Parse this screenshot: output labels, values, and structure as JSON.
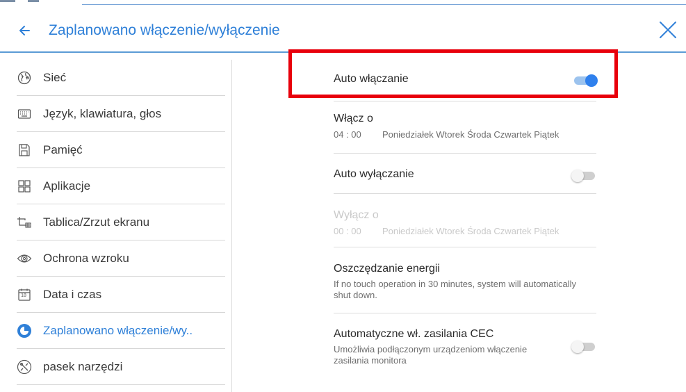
{
  "header": {
    "title": "Zaplanowano włączenie/wyłączenie",
    "back_icon": "arrow-left-icon",
    "close_icon": "close-icon"
  },
  "colors": {
    "accent": "#2f80d8",
    "divider": "#dcdcdc",
    "highlight": "#e8000b",
    "toggle_on": "#2f80ed"
  },
  "sidebar": {
    "items": [
      {
        "label": "Sieć",
        "icon": "globe-icon",
        "active": false
      },
      {
        "label": "Język, klawiatura, głos",
        "icon": "keyboard-icon",
        "active": false
      },
      {
        "label": "Pamięć",
        "icon": "storage-icon",
        "active": false
      },
      {
        "label": "Aplikacje",
        "icon": "apps-grid-icon",
        "active": false
      },
      {
        "label": "Tablica/Zrzut ekranu",
        "icon": "screenshot-icon",
        "active": false
      },
      {
        "label": "Ochrona wzroku",
        "icon": "eye-icon",
        "active": false
      },
      {
        "label": "Data i czas",
        "icon": "calendar-icon",
        "calendar_day": "18",
        "active": false
      },
      {
        "label": "Zaplanowano włączenie/wy..",
        "icon": "clock-icon",
        "active": true
      },
      {
        "label": "pasek narzędzi",
        "icon": "tools-icon",
        "active": false
      }
    ]
  },
  "settings": {
    "auto_on": {
      "title": "Auto włączanie",
      "enabled": true
    },
    "on_at": {
      "title": "Włącz o",
      "time": "04 : 00",
      "days": "Poniedziałek Wtorek Środa Czwartek Piątek"
    },
    "auto_off": {
      "title": "Auto wyłączanie",
      "enabled": false
    },
    "off_at": {
      "title": "Wyłącz o",
      "time": "00 : 00",
      "days": "Poniedziałek Wtorek Środa Czwartek Piątek"
    },
    "energy": {
      "title": "Oszczędzanie energii",
      "desc": "If no touch operation in  30 minutes, system will automatically shut down."
    },
    "cec": {
      "title": "Automatyczne wł. zasilania CEC",
      "desc": "Umożliwia podłączonym urządzeniom włączenie zasilania monitora",
      "enabled": false
    }
  }
}
